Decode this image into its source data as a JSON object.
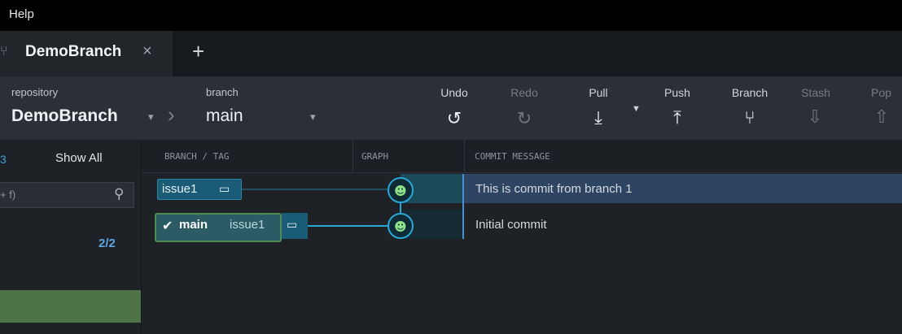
{
  "menu": {
    "help": "Help"
  },
  "tab": {
    "title": "DemoBranch",
    "close": "×",
    "add": "+",
    "icon": "repo-icon"
  },
  "toolbar": {
    "repository_label": "repository",
    "repository_value": "DemoBranch",
    "branch_label": "branch",
    "branch_value": "main",
    "buttons": [
      {
        "label": "Undo",
        "icon": "undo-icon",
        "enabled": true
      },
      {
        "label": "Redo",
        "icon": "redo-icon",
        "enabled": false
      },
      {
        "label": "Pull",
        "icon": "pull-icon",
        "enabled": true
      },
      {
        "label": "Push",
        "icon": "push-icon",
        "enabled": true
      },
      {
        "label": "Branch",
        "icon": "branch-icon",
        "enabled": true
      },
      {
        "label": "Stash",
        "icon": "stash-icon",
        "enabled": false
      },
      {
        "label": "Pop",
        "icon": "pop-icon",
        "enabled": false
      }
    ]
  },
  "sidebar": {
    "count_prefix": "3",
    "show_all": "Show All",
    "search_hint": "+ f)",
    "count": "2/2"
  },
  "graph": {
    "columns": [
      "BRANCH / TAG",
      "GRAPH",
      "COMMIT MESSAGE"
    ],
    "rows": [
      {
        "refs": [
          "issue1"
        ],
        "message": "This is commit from branch 1"
      },
      {
        "refs": [
          "main",
          "issue1"
        ],
        "message": "Initial commit"
      }
    ]
  },
  "colors": {
    "accent": "#4b8fd4",
    "branch_line": "#2aa7d6",
    "selected": "#4d7346"
  }
}
